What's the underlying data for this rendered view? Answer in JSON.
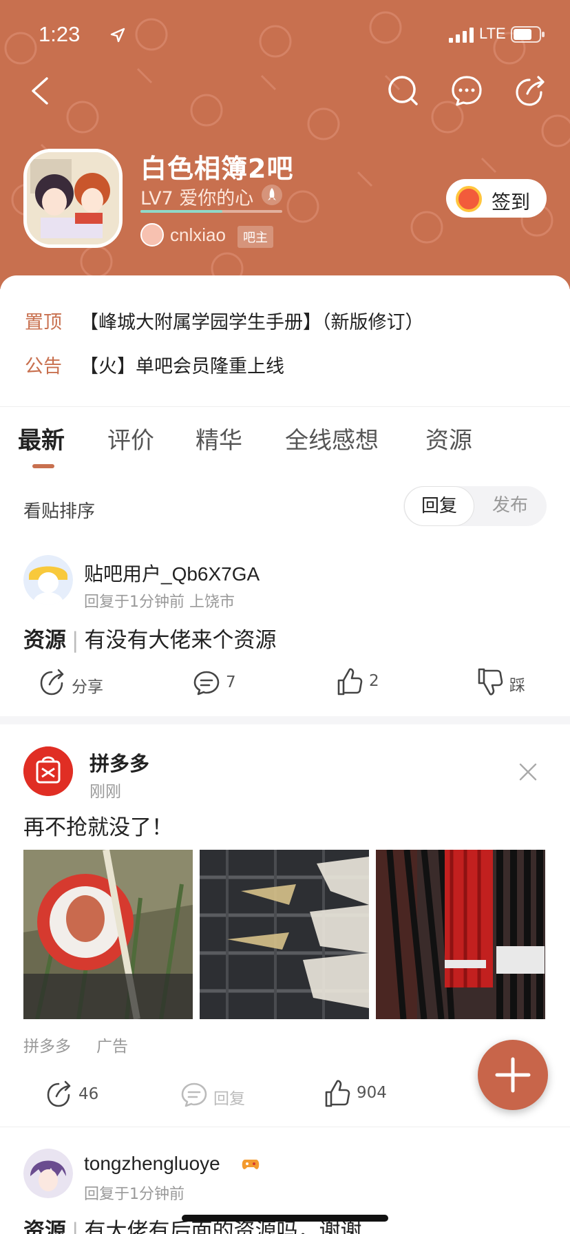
{
  "status_bar": {
    "time": "1:23",
    "network": "LTE"
  },
  "forum": {
    "title": "白色相簿2吧",
    "level": "LV7 爱你的心",
    "level_progress": 0.58,
    "owner_name": "cnlxiao",
    "owner_badge": "吧主",
    "sign_in_label": "签到"
  },
  "notices": [
    {
      "tag": "置顶",
      "text": "【峰城大附属学园学生手册】（新版修订）"
    },
    {
      "tag": "公告",
      "text": "【火】单吧会员隆重上线"
    }
  ],
  "tabs": [
    {
      "label": "最新",
      "active": true
    },
    {
      "label": "评价",
      "active": false
    },
    {
      "label": "精华",
      "active": false
    },
    {
      "label": "全线感想",
      "active": false
    },
    {
      "label": "资源",
      "active": false
    }
  ],
  "sort": {
    "label": "看贴排序",
    "options": [
      "回复",
      "发布"
    ],
    "selected": "回复"
  },
  "posts": [
    {
      "user": "贴吧用户_Qb6X7GA",
      "meta": "回复于1分钟前  上饶市",
      "category": "资源",
      "title": "有没有大佬来个资源",
      "share_label": "分享",
      "comments": "7",
      "likes": "2",
      "dislike_label": "踩"
    },
    {
      "user": "tongzhengluoye",
      "meta": "回复于1分钟前",
      "category": "资源",
      "title": "有大佬有后面的资源吗，谢谢"
    }
  ],
  "ad": {
    "name": "拼多多",
    "time": "刚刚",
    "text": "再不抢就没了！",
    "source": "拼多多",
    "label": "广告",
    "shares": "46",
    "reply_label": "回复",
    "likes": "904"
  },
  "colors": {
    "brand": "#c8704f",
    "accent_button": "#c8654a",
    "header_bg": "#c8704f"
  },
  "icons": [
    "back-icon",
    "search-icon",
    "chat-icon",
    "share-icon",
    "rocket-icon",
    "close-icon",
    "plus-icon",
    "comment-icon",
    "thumbs-up-icon",
    "thumbs-down-icon"
  ]
}
